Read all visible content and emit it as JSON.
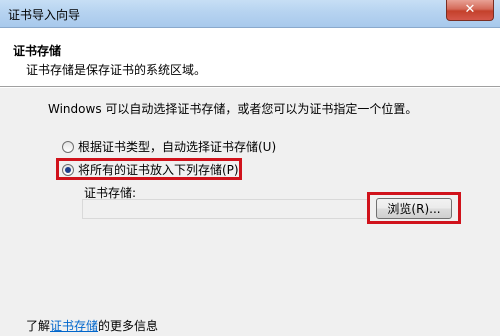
{
  "window": {
    "title": "证书导入向导",
    "close_label": "✕"
  },
  "header": {
    "title": "证书存储",
    "subtitle": "证书存储是保存证书的系统区域。"
  },
  "main": {
    "intro": "Windows 可以自动选择证书存储，或者您可以为证书指定一个位置。",
    "options": [
      {
        "label": "根据证书类型，自动选择证书存储(U)",
        "selected": false
      },
      {
        "label": "将所有的证书放入下列存储(P)",
        "selected": true
      }
    ],
    "store_label": "证书存储:",
    "store_value": "",
    "browse_label": "浏览(R)..."
  },
  "footer": {
    "prefix": "了解",
    "link": "证书存储",
    "suffix": "的更多信息"
  },
  "colors": {
    "highlight": "#d0121b",
    "link": "#0066cc"
  }
}
